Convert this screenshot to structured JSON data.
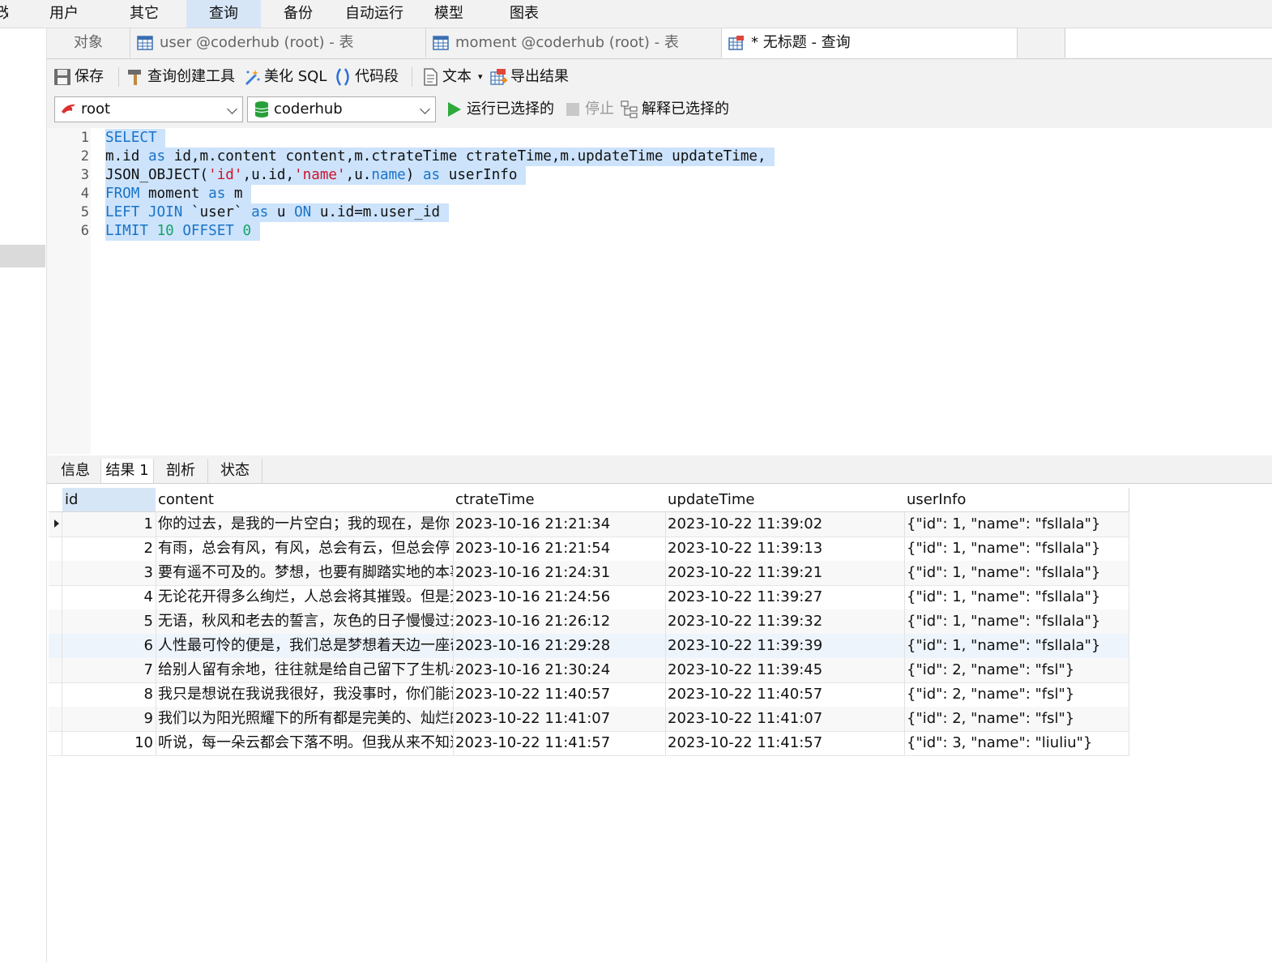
{
  "menu": {
    "cut": "改",
    "items": [
      "用户",
      "其它",
      "查询",
      "备份",
      "自动运行",
      "模型",
      "图表"
    ],
    "active_index": 2
  },
  "tabs": {
    "objects": "对象",
    "items": [
      {
        "label": "user @coderhub (root) - 表",
        "icon": "table-icon"
      },
      {
        "label": "moment @coderhub (root) - 表",
        "icon": "table-icon"
      },
      {
        "label": "* 无标题 - 查询",
        "icon": "query-icon"
      }
    ]
  },
  "toolbar": {
    "save": "保存",
    "query_builder": "查询创建工具",
    "beautify": "美化 SQL",
    "snippet": "代码段",
    "text": "文本",
    "export": "导出结果"
  },
  "connection": {
    "user": "root",
    "database": "coderhub",
    "run_selected": "运行已选择的",
    "stop": "停止",
    "explain_selected": "解释已选择的"
  },
  "editor": {
    "line_numbers": [
      "1",
      "2",
      "3",
      "4",
      "5",
      "6"
    ],
    "lines": [
      [
        [
          "SELECT",
          "kw"
        ]
      ],
      [
        [
          "m.id ",
          ""
        ],
        [
          "as",
          "kw"
        ],
        [
          " id,m.content content,m.ctrateTime ctrateTime,m.updateTime updateTime,",
          ""
        ]
      ],
      [
        [
          "JSON_OBJECT(",
          ""
        ],
        [
          "'id'",
          "str"
        ],
        [
          ",u.id,",
          ""
        ],
        [
          "'name'",
          "str"
        ],
        [
          ",u.",
          ""
        ],
        [
          "name",
          "kw"
        ],
        [
          ") ",
          ""
        ],
        [
          "as",
          "kw"
        ],
        [
          " userInfo",
          ""
        ]
      ],
      [
        [
          "FROM",
          "kw"
        ],
        [
          " moment ",
          ""
        ],
        [
          "as",
          "kw"
        ],
        [
          " m",
          ""
        ]
      ],
      [
        [
          "LEFT JOIN",
          "kw"
        ],
        [
          " `user` ",
          ""
        ],
        [
          "as",
          "kw"
        ],
        [
          " u ",
          ""
        ],
        [
          "ON",
          "kw"
        ],
        [
          " u.id=m.user_id",
          ""
        ]
      ],
      [
        [
          "LIMIT",
          "kw"
        ],
        [
          " ",
          ""
        ],
        [
          "10",
          "num"
        ],
        [
          " ",
          ""
        ],
        [
          "OFFSET",
          "kw"
        ],
        [
          " ",
          ""
        ],
        [
          "0",
          "num"
        ]
      ]
    ]
  },
  "result_tabs": [
    "信息",
    "结果 1",
    "剖析",
    "状态"
  ],
  "result_active_index": 1,
  "grid": {
    "columns": [
      "id",
      "content",
      "ctrateTime",
      "updateTime",
      "userInfo"
    ],
    "rows": [
      [
        "1",
        "你的过去，是我的一片空白；我的现在，是你",
        "2023-10-16 21:21:34",
        "2023-10-22 11:39:02",
        "{\"id\": 1, \"name\": \"fsllala\"}"
      ],
      [
        "2",
        "有雨，总会有风，有风，总会有云，但总会停",
        "2023-10-16 21:21:54",
        "2023-10-22 11:39:13",
        "{\"id\": 1, \"name\": \"fsllala\"}"
      ],
      [
        "3",
        "要有遥不可及的。梦想，也要有脚踏实地的本事",
        "2023-10-16 21:24:31",
        "2023-10-22 11:39:21",
        "{\"id\": 1, \"name\": \"fsllala\"}"
      ],
      [
        "4",
        "无论花开得多么绚烂，人总会将其摧毁。但是无",
        "2023-10-16 21:24:56",
        "2023-10-22 11:39:27",
        "{\"id\": 1, \"name\": \"fsllala\"}"
      ],
      [
        "5",
        "无语，秋风和老去的誓言，灰色的日子慢慢过去",
        "2023-10-16 21:26:12",
        "2023-10-22 11:39:32",
        "{\"id\": 1, \"name\": \"fsllala\"}"
      ],
      [
        "6",
        "人性最可怜的便是，我们总是梦想着天边一座奇",
        "2023-10-16 21:29:28",
        "2023-10-22 11:39:39",
        "{\"id\": 1, \"name\": \"fsllala\"}"
      ],
      [
        "7",
        "给别人留有余地，往往就是给自己留下了生机与",
        "2023-10-16 21:30:24",
        "2023-10-22 11:39:45",
        "{\"id\": 2, \"name\": \"fsl\"}"
      ],
      [
        "8",
        "我只是想说在我说我很好，我没事时，你们能读",
        "2023-10-22 11:40:57",
        "2023-10-22 11:40:57",
        "{\"id\": 2, \"name\": \"fsl\"}"
      ],
      [
        "9",
        "我们以为阳光照耀下的所有都是完美的、灿烂的",
        "2023-10-22 11:41:07",
        "2023-10-22 11:41:07",
        "{\"id\": 2, \"name\": \"fsl\"}"
      ],
      [
        "10",
        "听说，每一朵云都会下落不明。但我从来不知道",
        "2023-10-22 11:41:57",
        "2023-10-22 11:41:57",
        "{\"id\": 3, \"name\": \"liuliu\"}"
      ]
    ]
  },
  "colors": {
    "accent": "#d6e6f7",
    "keyword": "#1a73c8",
    "string": "#d0112b",
    "number": "#19a36a",
    "selection": "#cce3fb",
    "run_green": "#2eaa3c"
  }
}
